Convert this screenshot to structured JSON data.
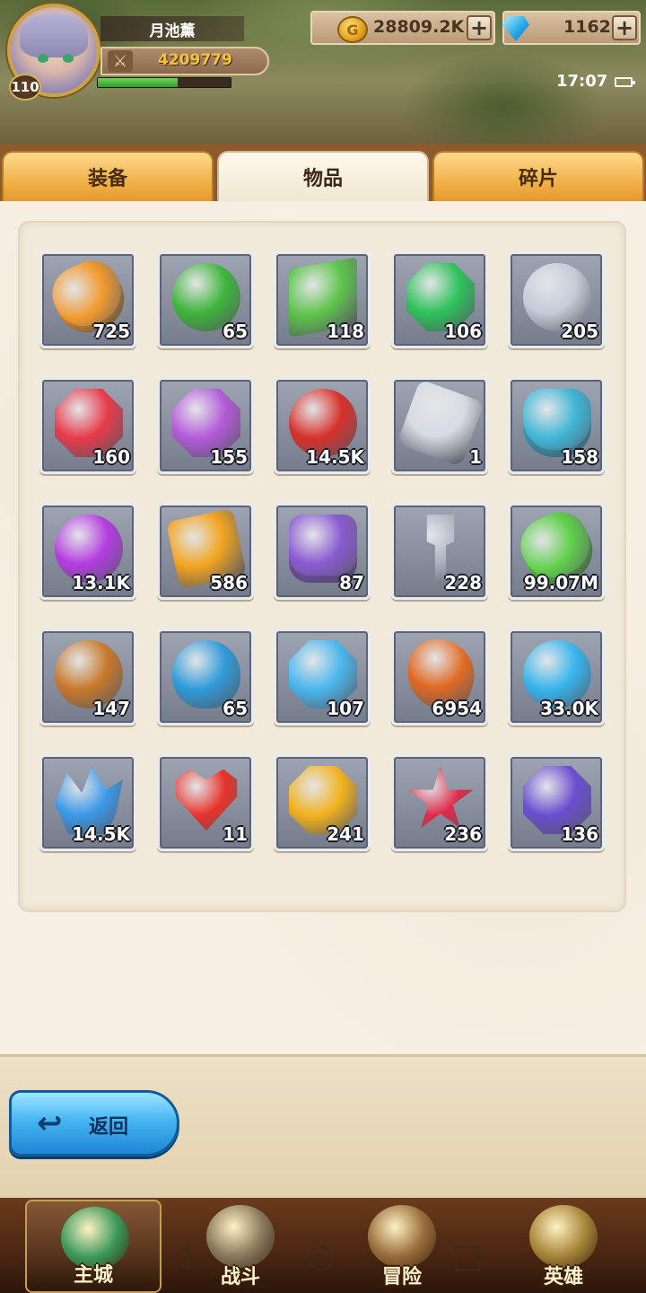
{
  "player": {
    "name": "月池薰",
    "level": "110",
    "power": "4209779",
    "exp_fraction": 0.6
  },
  "resources": {
    "gold": "28809.2K",
    "gems": "1162",
    "plus_label": "+"
  },
  "status": {
    "time": "17:07"
  },
  "tabs": [
    {
      "label": "装备",
      "active": false
    },
    {
      "label": "物品",
      "active": true
    },
    {
      "label": "碎片",
      "active": false
    }
  ],
  "items": [
    {
      "icon": "orange-potion-icon",
      "count": "725",
      "color": "#f29a2e",
      "shape": "potion"
    },
    {
      "icon": "four-leaf-clover-icon",
      "count": "65",
      "color": "#3fb53a",
      "shape": "clover"
    },
    {
      "icon": "green-scroll-icon",
      "count": "118",
      "color": "#5ec44c",
      "shape": "scroll"
    },
    {
      "icon": "green-fist-gem-icon",
      "count": "106",
      "color": "#2ec25a",
      "shape": "octagon"
    },
    {
      "icon": "silver-coin-icon",
      "count": "205",
      "color": "#c4ccd8",
      "shape": "circle"
    },
    {
      "icon": "red-sword-gem-icon",
      "count": "160",
      "color": "#e83a4a",
      "shape": "octagon"
    },
    {
      "icon": "purple-helmet-gem-icon",
      "count": "155",
      "color": "#b35ad8",
      "shape": "octagon"
    },
    {
      "icon": "red-potion-icon",
      "count": "14.5K",
      "color": "#d8302a",
      "shape": "circle"
    },
    {
      "icon": "skull-die-icon",
      "count": "1",
      "color": "#d8dbe2",
      "shape": "die"
    },
    {
      "icon": "blue-vase-icon",
      "count": "158",
      "color": "#3fb6d6",
      "shape": "vase"
    },
    {
      "icon": "purple-potion-icon",
      "count": "13.1K",
      "color": "#b43ce0",
      "shape": "circle"
    },
    {
      "icon": "lightning-rune-icon",
      "count": "586",
      "color": "#f2a41e",
      "shape": "rune"
    },
    {
      "icon": "purple-crystal-jar-icon",
      "count": "87",
      "color": "#8a5ad0",
      "shape": "jar"
    },
    {
      "icon": "silver-key-icon",
      "count": "228",
      "color": "#aab2bd",
      "shape": "key"
    },
    {
      "icon": "green-bottle-icon",
      "count": "99.07M",
      "color": "#5fd04a",
      "shape": "potion"
    },
    {
      "icon": "bronze-coin-icon",
      "count": "147",
      "color": "#c8782a",
      "shape": "circle"
    },
    {
      "icon": "blue-orb-egg-icon",
      "count": "65",
      "color": "#2e9ad8",
      "shape": "egg"
    },
    {
      "icon": "blue-shield-gem-icon",
      "count": "107",
      "color": "#4ab6ec",
      "shape": "octagon"
    },
    {
      "icon": "orange-rock-icon",
      "count": "6954",
      "color": "#e06a22",
      "shape": "rock"
    },
    {
      "icon": "blue-sphere-icon",
      "count": "33.0K",
      "color": "#36b4ec",
      "shape": "circle"
    },
    {
      "icon": "blue-crystal-cluster-icon",
      "count": "14.5K",
      "color": "#3a98e8",
      "shape": "crystal"
    },
    {
      "icon": "red-heart-icon",
      "count": "11",
      "color": "#e8322a",
      "shape": "heart"
    },
    {
      "icon": "yellow-armor-gem-icon",
      "count": "241",
      "color": "#f2b21e",
      "shape": "octagon"
    },
    {
      "icon": "red-star-gem-icon",
      "count": "236",
      "color": "#e02a4a",
      "shape": "star"
    },
    {
      "icon": "purple-boots-gem-icon",
      "count": "136",
      "color": "#6a4ed0",
      "shape": "octagon"
    }
  ],
  "back_button": {
    "label": "返回"
  },
  "bottom_nav": [
    {
      "label": "主城",
      "icon": "main-city-emblem-icon",
      "active": true,
      "color": "#3c9a5c"
    },
    {
      "label": "战斗",
      "icon": "crossed-swords-icon",
      "active": false,
      "color": "#8a7a5e"
    },
    {
      "label": "冒险",
      "icon": "adventure-map-icon",
      "active": false,
      "color": "#9a6e3c"
    },
    {
      "label": "英雄",
      "icon": "hero-crest-icon",
      "active": false,
      "color": "#a8863a"
    }
  ]
}
